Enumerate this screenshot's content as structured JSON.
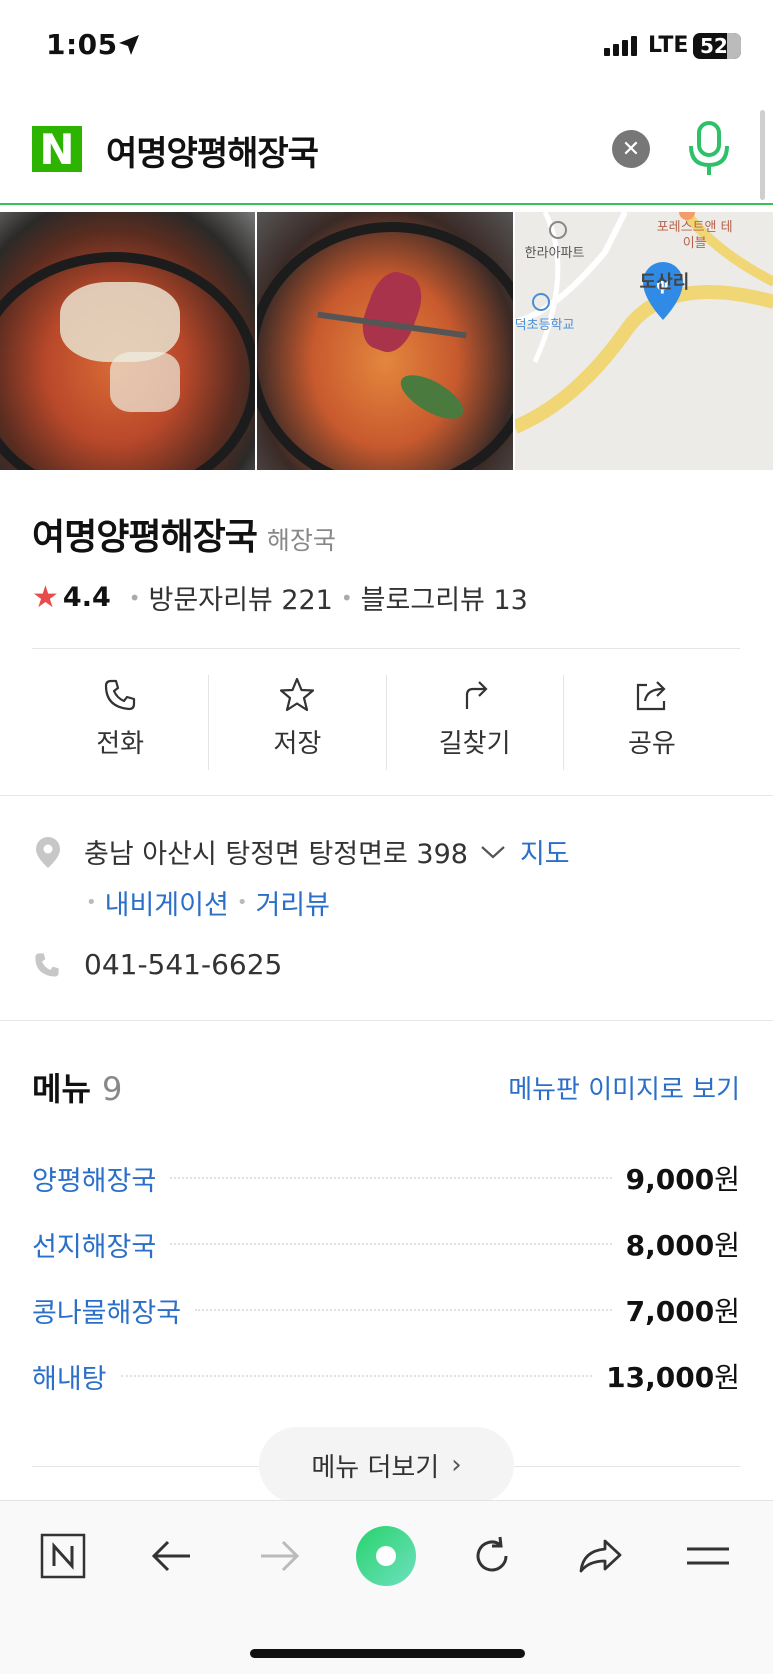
{
  "status_bar": {
    "time": "1:05",
    "network": "LTE",
    "battery": "52"
  },
  "search": {
    "logo": "N",
    "query": "여명양평해장국"
  },
  "photos": [
    {
      "name": "haejangguk-photo-1"
    },
    {
      "name": "haejangguk-photo-2"
    },
    {
      "name": "map-thumbnail",
      "labels": [
        "포레스트앤 테이블",
        "한라아파트",
        "덕초등학교",
        "도산리"
      ]
    }
  ],
  "place": {
    "name": "여명양평해장국",
    "category": "해장국",
    "rating": "4.4",
    "visitor_reviews": "방문자리뷰 221",
    "blog_reviews": "블로그리뷰 13"
  },
  "actions": [
    {
      "label": "전화",
      "icon": "phone-icon"
    },
    {
      "label": "저장",
      "icon": "star-icon"
    },
    {
      "label": "길찾기",
      "icon": "directions-icon"
    },
    {
      "label": "공유",
      "icon": "share-icon"
    }
  ],
  "address": {
    "text": "충남 아산시 탕정면 탕정면로 398",
    "map_link": "지도",
    "navigation_link": "내비게이션",
    "streetview_link": "거리뷰"
  },
  "phone": "041-541-6625",
  "menu": {
    "title": "메뉴",
    "count": "9",
    "image_link": "메뉴판 이미지로 보기",
    "items": [
      {
        "name": "양평해장국",
        "price": "9,000",
        "unit": "원"
      },
      {
        "name": "선지해장국",
        "price": "8,000",
        "unit": "원"
      },
      {
        "name": "콩나물해장국",
        "price": "7,000",
        "unit": "원"
      },
      {
        "name": "해내탕",
        "price": "13,000",
        "unit": "원"
      }
    ],
    "more_label": "메뉴 더보기"
  },
  "colors": {
    "accent_green": "#2db400",
    "link_blue": "#2b6fc8",
    "star_red": "#e94b4b"
  }
}
